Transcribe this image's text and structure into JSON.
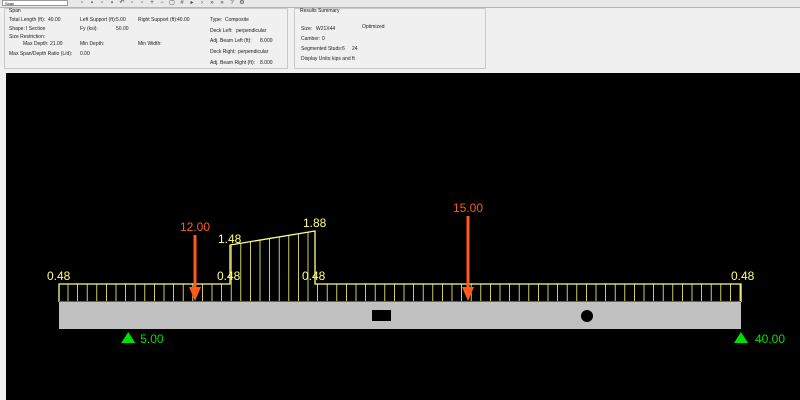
{
  "toolbar": {
    "span_selector": "Span",
    "icons": [
      "new-icon",
      "open-icon",
      "save-icon",
      "print-icon",
      "undo-icon",
      "copy-icon",
      "paste-icon",
      "zoom-in-icon",
      "zoom-out-icon",
      "fit-icon",
      "grid-icon",
      "play-icon",
      "step-icon",
      "next-icon",
      "last-icon",
      "help-icon",
      "settings-icon"
    ]
  },
  "span_panel": {
    "title": "Span",
    "total_length_label": "Total Length (ft):",
    "total_length_value": "40.00",
    "left_support_label": "Left Support (ft):",
    "left_support_value": "5.00",
    "right_support_label": "Right Support (ft):",
    "right_support_value": "40.00",
    "shape_label": "Shape:",
    "shape_value": "I Section",
    "fy_label": "Fy (ksi):",
    "fy_value": "50.00",
    "size_restriction_label": "Size Restriction:",
    "max_depth_label": "Max Depth:",
    "max_depth_value": "21.00",
    "min_depth_label": "Min Depth:",
    "min_width_label": "Min Width:",
    "max_ratio_label": "Max Span/Depth Ratio (L/d):",
    "max_ratio_value": "0.00",
    "type_label": "Type:",
    "type_value": "Composite",
    "deck_left_label": "Deck Left:",
    "deck_left_value": "perpendicular",
    "adj_beam_left_label": "Adj. Beam Left (ft):",
    "adj_beam_left_value": "8.000",
    "deck_right_label": "Deck Right:",
    "deck_right_value": "perpendicular",
    "adj_beam_right_label": "Adj. Beam Right (ft):",
    "adj_beam_right_value": "8.000"
  },
  "results_panel": {
    "title": "Results Summary",
    "size_label": "Size:",
    "size_value": "W21X44",
    "optimized_label": "Optimized",
    "camber_label": "Camber:",
    "camber_value": "0",
    "studs_label": "Segmented Studs:",
    "studs_value_1": "6",
    "studs_value_2": "24",
    "units_label": "Display Units:",
    "units_value": "kips and ft"
  },
  "colors": {
    "canvas_bg": "#000000",
    "load_line": "#ffff80",
    "point_load": "#ff5a1a",
    "beam_fill": "#c0c0c0",
    "support": "#00e000",
    "red_line": "#ff2020"
  },
  "chart_data": {
    "type": "beam-diagram",
    "beam_length_ft": 40,
    "distributed_load": {
      "base_value": 0.48,
      "base_labels": [
        "0.48",
        "0.48",
        "0.48",
        "0.48"
      ],
      "trapezoid": {
        "start_value": 1.48,
        "end_value": 1.88,
        "start_label": "1.48",
        "end_label": "1.88"
      }
    },
    "point_loads": [
      {
        "label": "12.00",
        "value": 12.0
      },
      {
        "label": "15.00",
        "value": 15.0
      }
    ],
    "supports": [
      {
        "label": "5.00",
        "position_ft": 5.0
      },
      {
        "label": "40.00",
        "position_ft": 40.0
      }
    ],
    "beam_markers": [
      "rectangle",
      "circle"
    ]
  }
}
